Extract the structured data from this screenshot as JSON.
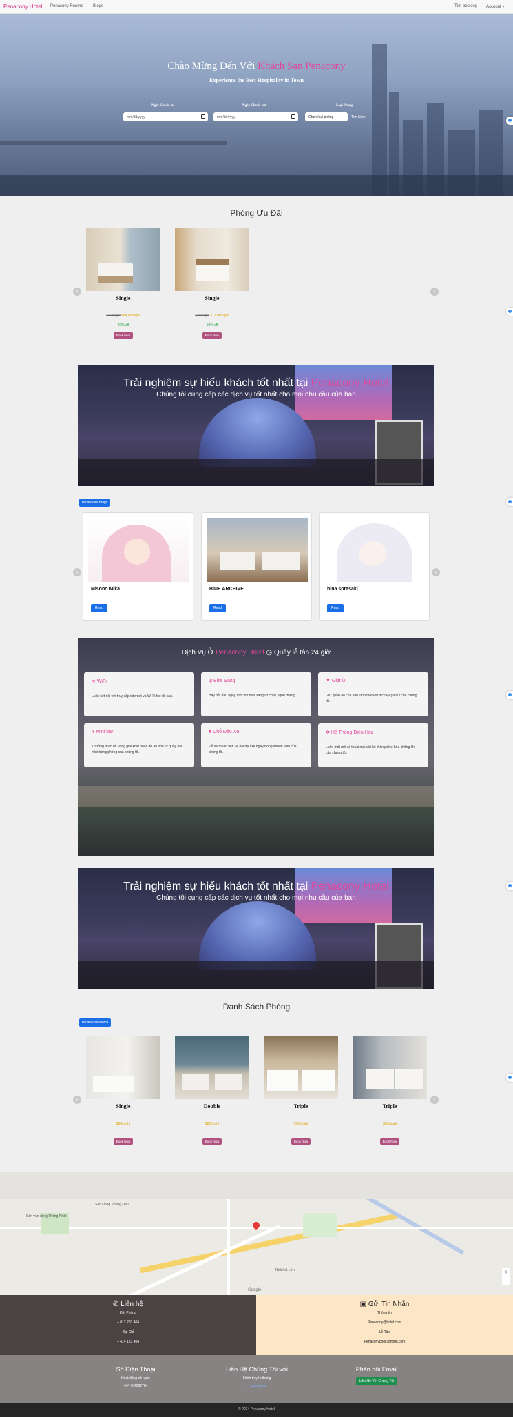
{
  "nav": {
    "brand": "Penacony Hotel",
    "links": [
      "Penacony Rooms",
      "Blogs"
    ],
    "right": [
      "Tìm booking",
      "Account"
    ]
  },
  "hero": {
    "title_prefix": "Chào Mừng Đến Với ",
    "title_highlight": "Khách Sạn Penacony",
    "subtitle": "Experience the Best Hospitality in Town",
    "checkin_label": "Ngày Check-in",
    "checkin_placeholder": "mm/dd/yyyy",
    "checkout_label": "Ngày Check-out",
    "checkout_placeholder": "mm/dd/yyyy",
    "roomtype_label": "Loại Phòng",
    "roomtype_value": "Chọn loại phòng",
    "search_label": "Tìm kiếm"
  },
  "featured": {
    "title": "Phòng Ưu Đãi",
    "rooms": [
      {
        "name": "Single",
        "old_price": "$80/night",
        "new_price": "$64.00/night",
        "discount": "20% off",
        "button": "Book Now"
      },
      {
        "name": "Single",
        "old_price": "$80/night",
        "new_price": "$72.00/night",
        "discount": "10% off",
        "button": "Book Now"
      }
    ]
  },
  "banner": {
    "prefix": "Trải nghiệm sự hiếu khách tốt nhất tại ",
    "highlight": "Penacony Hotel",
    "sub": "Chúng tôi cung cấp các dịch vụ tốt nhất cho mọi nhu cầu của bạn"
  },
  "blogs": {
    "browse_label": "Browse All Blogs",
    "items": [
      {
        "title": "Misono Mika",
        "button": "Read"
      },
      {
        "title": "BlUE ARCHIVE",
        "button": "Read"
      },
      {
        "title": "hina sorasaki",
        "button": "Read"
      }
    ]
  },
  "services": {
    "title_prefix": "Dịch Vụ Ở ",
    "title_highlight": "Penacony Hotel",
    "title_suffix": "Quầy lễ tân 24 giờ",
    "items": [
      {
        "name": "WiFi",
        "icon": "wifi-icon",
        "desc": "Luôn kết nối với truy cập internet và Wi-Fi tốc độ cao."
      },
      {
        "name": "Bữa Sáng",
        "icon": "utensils-icon",
        "desc": "Hãy bắt đầu ngày mới với bữa sáng tự chọn ngon miệng."
      },
      {
        "name": "Giặt Ủi",
        "icon": "shirt-icon",
        "desc": "Giữ quần áo của bạn luôn mới với dịch vụ giặt ủi của chúng tôi."
      },
      {
        "name": "Mini bar",
        "icon": "cocktail-icon",
        "desc": "Thưởng thức đồ uống giải khát hoặc đồ ăn nhẹ từ quầy bar mini trong phòng của chúng tôi."
      },
      {
        "name": "Chỗ Đậu Xe",
        "icon": "car-icon",
        "desc": "Đỗ xe thuận tiện tại bãi đậu xe ngay trong khuôn viên của chúng tôi."
      },
      {
        "name": "Hệ Thống Điều Hòa",
        "icon": "snowflake-icon",
        "desc": "Luôn mát mẻ và thoải mái với hệ thống điều hòa không khí của chúng tôi."
      }
    ]
  },
  "roomlist": {
    "title": "Danh Sách Phòng",
    "browse_label": "Browse all rooms",
    "rooms": [
      {
        "name": "Single",
        "price": "$80/night",
        "button": "Book Now"
      },
      {
        "name": "Double",
        "price": "$80/night",
        "button": "Book Now"
      },
      {
        "name": "Triple",
        "price": "$70/night",
        "button": "Book Now"
      },
      {
        "name": "Triple",
        "price": "$80/night",
        "button": "Book Now"
      }
    ]
  },
  "map": {
    "labels": [
      "Sân Đông Phong Đầu",
      "Sân vận động Thống Nhất",
      "Nhà hát Lớn",
      "Google"
    ]
  },
  "contact": {
    "left_title": "Liên hệ",
    "left_lines": [
      "Đặt Phòng",
      "+ 012 203 404",
      "Đại Chỉ",
      "+ 414 123 404"
    ],
    "right_title": "Gửi Tin Nhắn",
    "right_lines": [
      "Thông tin",
      "Penacony@hotel.com",
      "Lễ Tân",
      "Penaconybook@hotel.com"
    ]
  },
  "footer": {
    "phone_title": "Số Điện Thoại",
    "phone_sub": "Hoạt động cả ngày",
    "phone_num": "+84 704262784",
    "contact_title": "Liên Hệ Chúng Tôi với",
    "contact_sub": "Kênh truyền thông",
    "contact_link": "Facebook",
    "feedback_title": "Phản hồi Email",
    "feedback_button": "Liên Hệ Với Chúng Tôi",
    "copyright": "© 2024 Penacony Hotel"
  },
  "colors": {
    "accent": "#e0479a",
    "primary": "#1a6fe8",
    "book_btn": "#b0517f"
  }
}
